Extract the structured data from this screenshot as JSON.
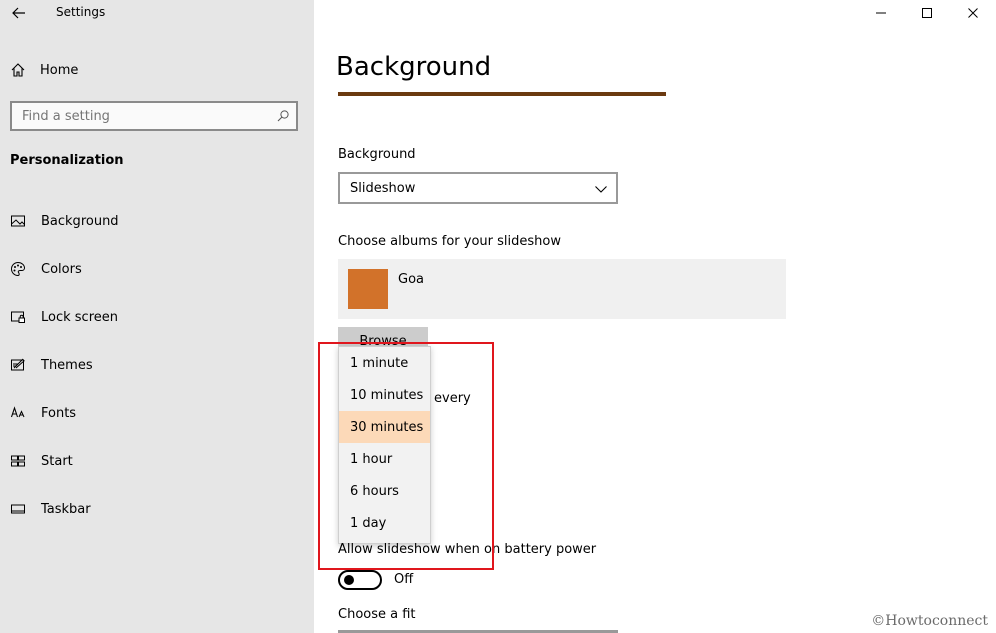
{
  "window": {
    "title": "Settings",
    "controls": {
      "minimize": "minimize-icon",
      "maximize": "maximize-icon",
      "close": "close-icon"
    }
  },
  "sidebar": {
    "home_label": "Home",
    "search_placeholder": "Find a setting",
    "section_title": "Personalization",
    "items": [
      {
        "label": "Background",
        "icon": "image-icon"
      },
      {
        "label": "Colors",
        "icon": "palette-icon"
      },
      {
        "label": "Lock screen",
        "icon": "lock-screen-icon"
      },
      {
        "label": "Themes",
        "icon": "themes-icon"
      },
      {
        "label": "Fonts",
        "icon": "fonts-icon"
      },
      {
        "label": "Start",
        "icon": "start-icon"
      },
      {
        "label": "Taskbar",
        "icon": "taskbar-icon"
      }
    ]
  },
  "main": {
    "title": "Background",
    "background_label": "Background",
    "background_value": "Slideshow",
    "albums_label": "Choose albums for your slideshow",
    "album_name": "Goa",
    "browse_label": "Browse",
    "change_every_partial": "every",
    "interval_options": [
      "1 minute",
      "10 minutes",
      "30 minutes",
      "1 hour",
      "6 hours",
      "1 day"
    ],
    "interval_selected": "30 minutes",
    "battery_label": "Allow slideshow when on battery power",
    "battery_toggle": "Off",
    "fit_label": "Choose a fit"
  },
  "watermark": "©Howtoconnect",
  "colors": {
    "accent_bar": "#6b3a10",
    "album_thumb": "#d2722a",
    "selected_option": "#fcd9b8",
    "highlight_box": "#e0161d"
  }
}
